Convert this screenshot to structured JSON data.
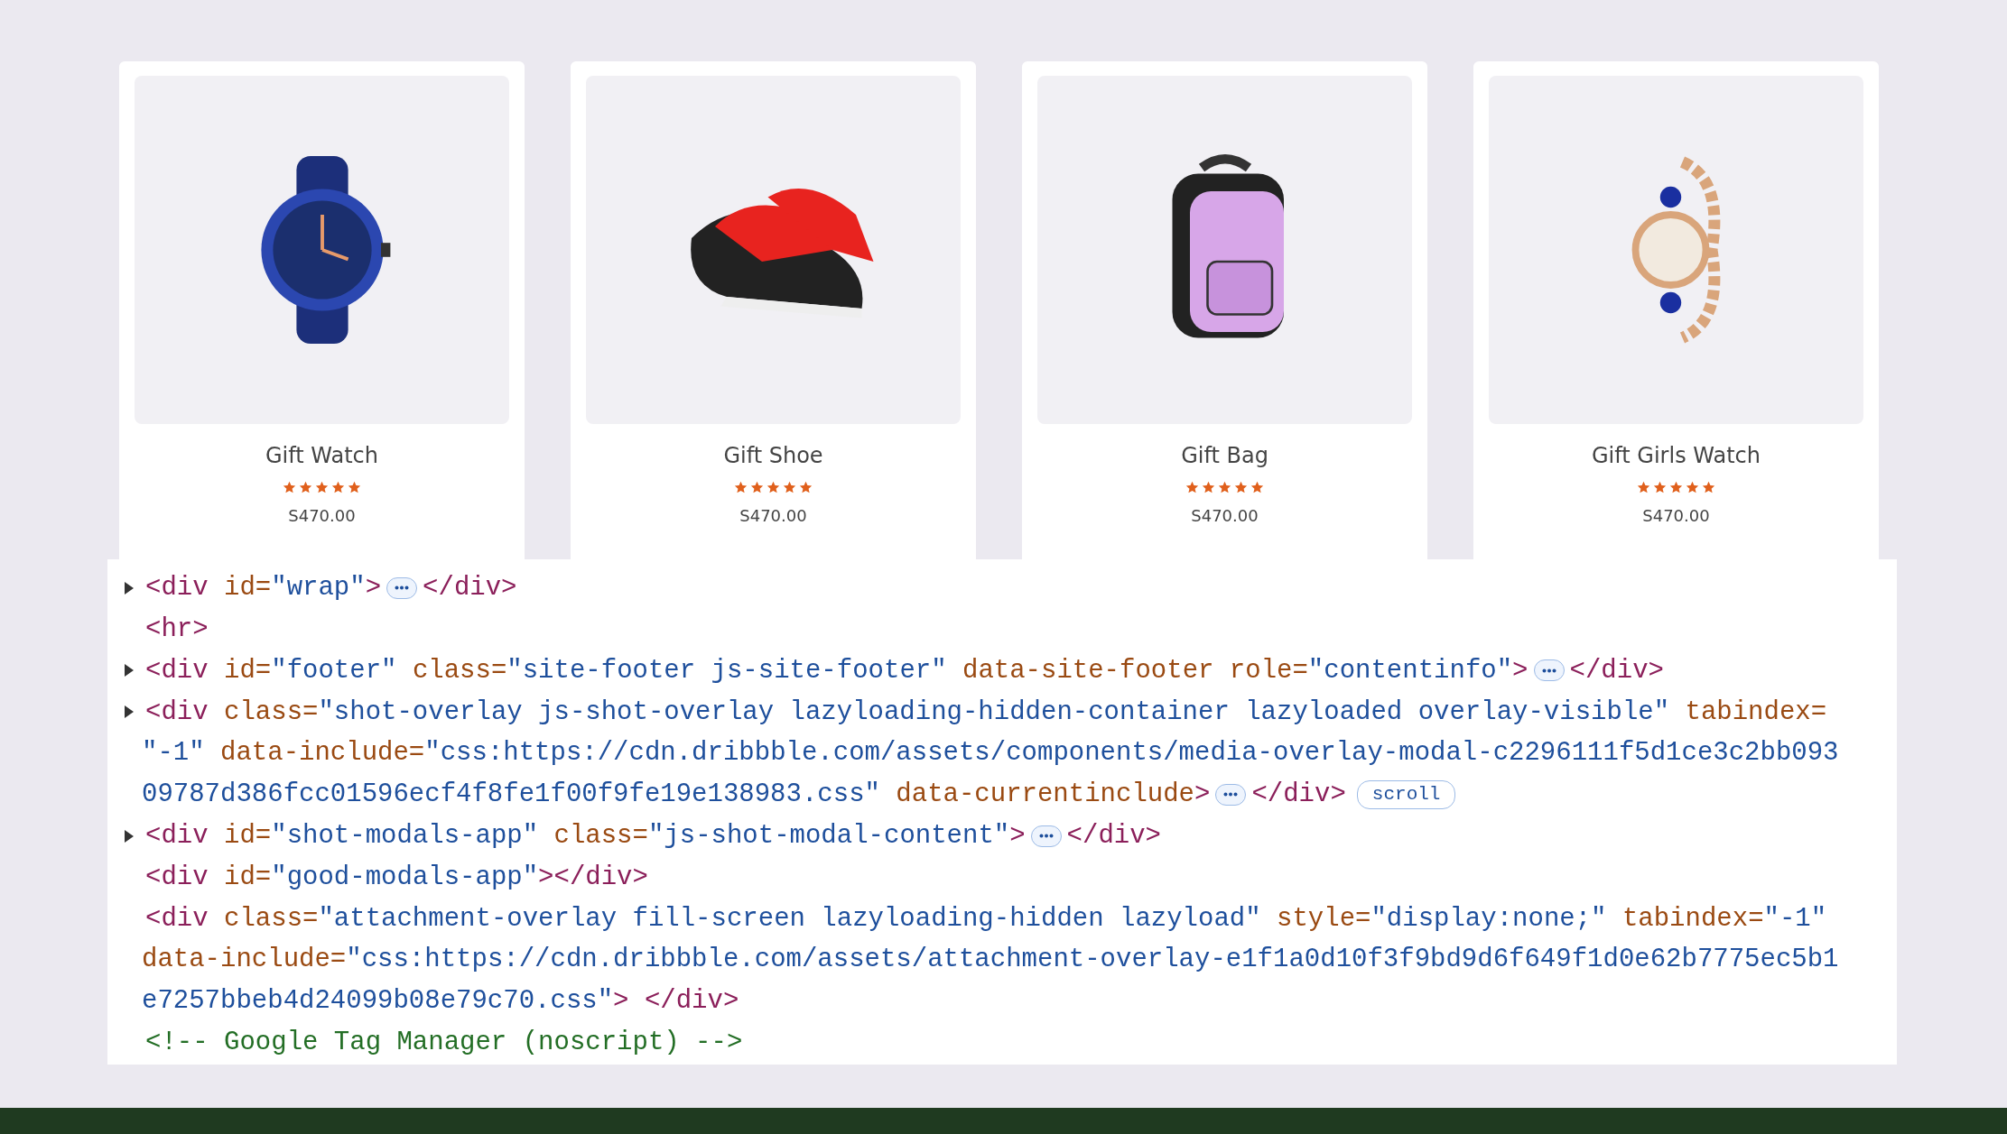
{
  "products": [
    {
      "name": "Gift Watch",
      "stars": 5,
      "price": "S470.00"
    },
    {
      "name": "Gift Shoe",
      "stars": 5,
      "price": "S470.00"
    },
    {
      "name": "Gift Bag",
      "stars": 5,
      "price": "S470.00"
    },
    {
      "name": "Gift Girls Watch",
      "stars": 5,
      "price": "S470.00"
    }
  ],
  "code_lines": [
    {
      "kind": "node",
      "expanded": false,
      "tokens": [
        {
          "kind": "tag",
          "text": "<div"
        },
        {
          "kind": "attr",
          "text": " id="
        },
        {
          "kind": "value",
          "text": "\"wrap\""
        },
        {
          "kind": "tag",
          "text": ">"
        },
        {
          "kind": "ellipsis"
        },
        {
          "kind": "tag",
          "text": "</div>"
        }
      ]
    },
    {
      "kind": "plain",
      "tokens": [
        {
          "kind": "tag",
          "text": "<hr>"
        }
      ]
    },
    {
      "kind": "node",
      "expanded": false,
      "tokens": [
        {
          "kind": "tag",
          "text": "<div"
        },
        {
          "kind": "attr",
          "text": " id="
        },
        {
          "kind": "value",
          "text": "\"footer\""
        },
        {
          "kind": "attr",
          "text": " class="
        },
        {
          "kind": "value",
          "text": "\"site-footer js-site-footer\""
        },
        {
          "kind": "attr",
          "text": " data-site-footer role="
        },
        {
          "kind": "value",
          "text": "\"contentinfo\""
        },
        {
          "kind": "tag",
          "text": ">"
        },
        {
          "kind": "ellipsis"
        },
        {
          "kind": "tag",
          "text": "</div>"
        }
      ]
    },
    {
      "kind": "node",
      "expanded": false,
      "tokens": [
        {
          "kind": "tag",
          "text": "<div"
        },
        {
          "kind": "attr",
          "text": " class="
        },
        {
          "kind": "value",
          "text": "\"shot-overlay js-shot-overlay lazyloading-hidden-container lazyloaded overlay-visible\""
        },
        {
          "kind": "attr",
          "text": " tabindex="
        }
      ]
    },
    {
      "kind": "wrap",
      "tokens": [
        {
          "kind": "value",
          "text": "\"-1\""
        },
        {
          "kind": "attr",
          "text": " data-include="
        },
        {
          "kind": "value",
          "text": "\"css:https://cdn.dribbble.com/assets/components/media-overlay-modal-c2296111f5d1ce3c2bb093"
        }
      ]
    },
    {
      "kind": "wrap",
      "tokens": [
        {
          "kind": "value",
          "text": "09787d386fcc01596ecf4f8fe1f00f9fe19e138983.css\""
        },
        {
          "kind": "attr",
          "text": " data-currentinclude"
        },
        {
          "kind": "tag",
          "text": ">"
        },
        {
          "kind": "ellipsis"
        },
        {
          "kind": "tag",
          "text": "</div>"
        },
        {
          "kind": "badge",
          "text": "scroll"
        }
      ]
    },
    {
      "kind": "node",
      "expanded": false,
      "tokens": [
        {
          "kind": "tag",
          "text": "<div"
        },
        {
          "kind": "attr",
          "text": " id="
        },
        {
          "kind": "value",
          "text": "\"shot-modals-app\""
        },
        {
          "kind": "attr",
          "text": " class="
        },
        {
          "kind": "value",
          "text": "\"js-shot-modal-content\""
        },
        {
          "kind": "tag",
          "text": ">"
        },
        {
          "kind": "ellipsis"
        },
        {
          "kind": "tag",
          "text": "</div>"
        }
      ]
    },
    {
      "kind": "plain",
      "tokens": [
        {
          "kind": "tag",
          "text": "<div"
        },
        {
          "kind": "attr",
          "text": " id="
        },
        {
          "kind": "value",
          "text": "\"good-modals-app\""
        },
        {
          "kind": "tag",
          "text": "></div>"
        }
      ]
    },
    {
      "kind": "plain",
      "tokens": [
        {
          "kind": "tag",
          "text": "<div"
        },
        {
          "kind": "attr",
          "text": " class="
        },
        {
          "kind": "value",
          "text": "\"attachment-overlay fill-screen lazyloading-hidden lazyload\""
        },
        {
          "kind": "attr",
          "text": " style="
        },
        {
          "kind": "value",
          "text": "\"display:none;\""
        },
        {
          "kind": "attr",
          "text": " tabindex="
        },
        {
          "kind": "value",
          "text": "\"-1\""
        }
      ]
    },
    {
      "kind": "wrap",
      "tokens": [
        {
          "kind": "attr",
          "text": "data-include="
        },
        {
          "kind": "value",
          "text": "\"css:https://cdn.dribbble.com/assets/attachment-overlay-e1f1a0d10f3f9bd9d6f649f1d0e62b7775ec5b1"
        }
      ]
    },
    {
      "kind": "wrap",
      "tokens": [
        {
          "kind": "value",
          "text": "e7257bbeb4d24099b08e79c70.css\""
        },
        {
          "kind": "tag",
          "text": "> </div>"
        }
      ]
    },
    {
      "kind": "plain",
      "tokens": [
        {
          "kind": "comment",
          "text": "<!-- Google Tag Manager (noscript) -->"
        }
      ]
    }
  ]
}
